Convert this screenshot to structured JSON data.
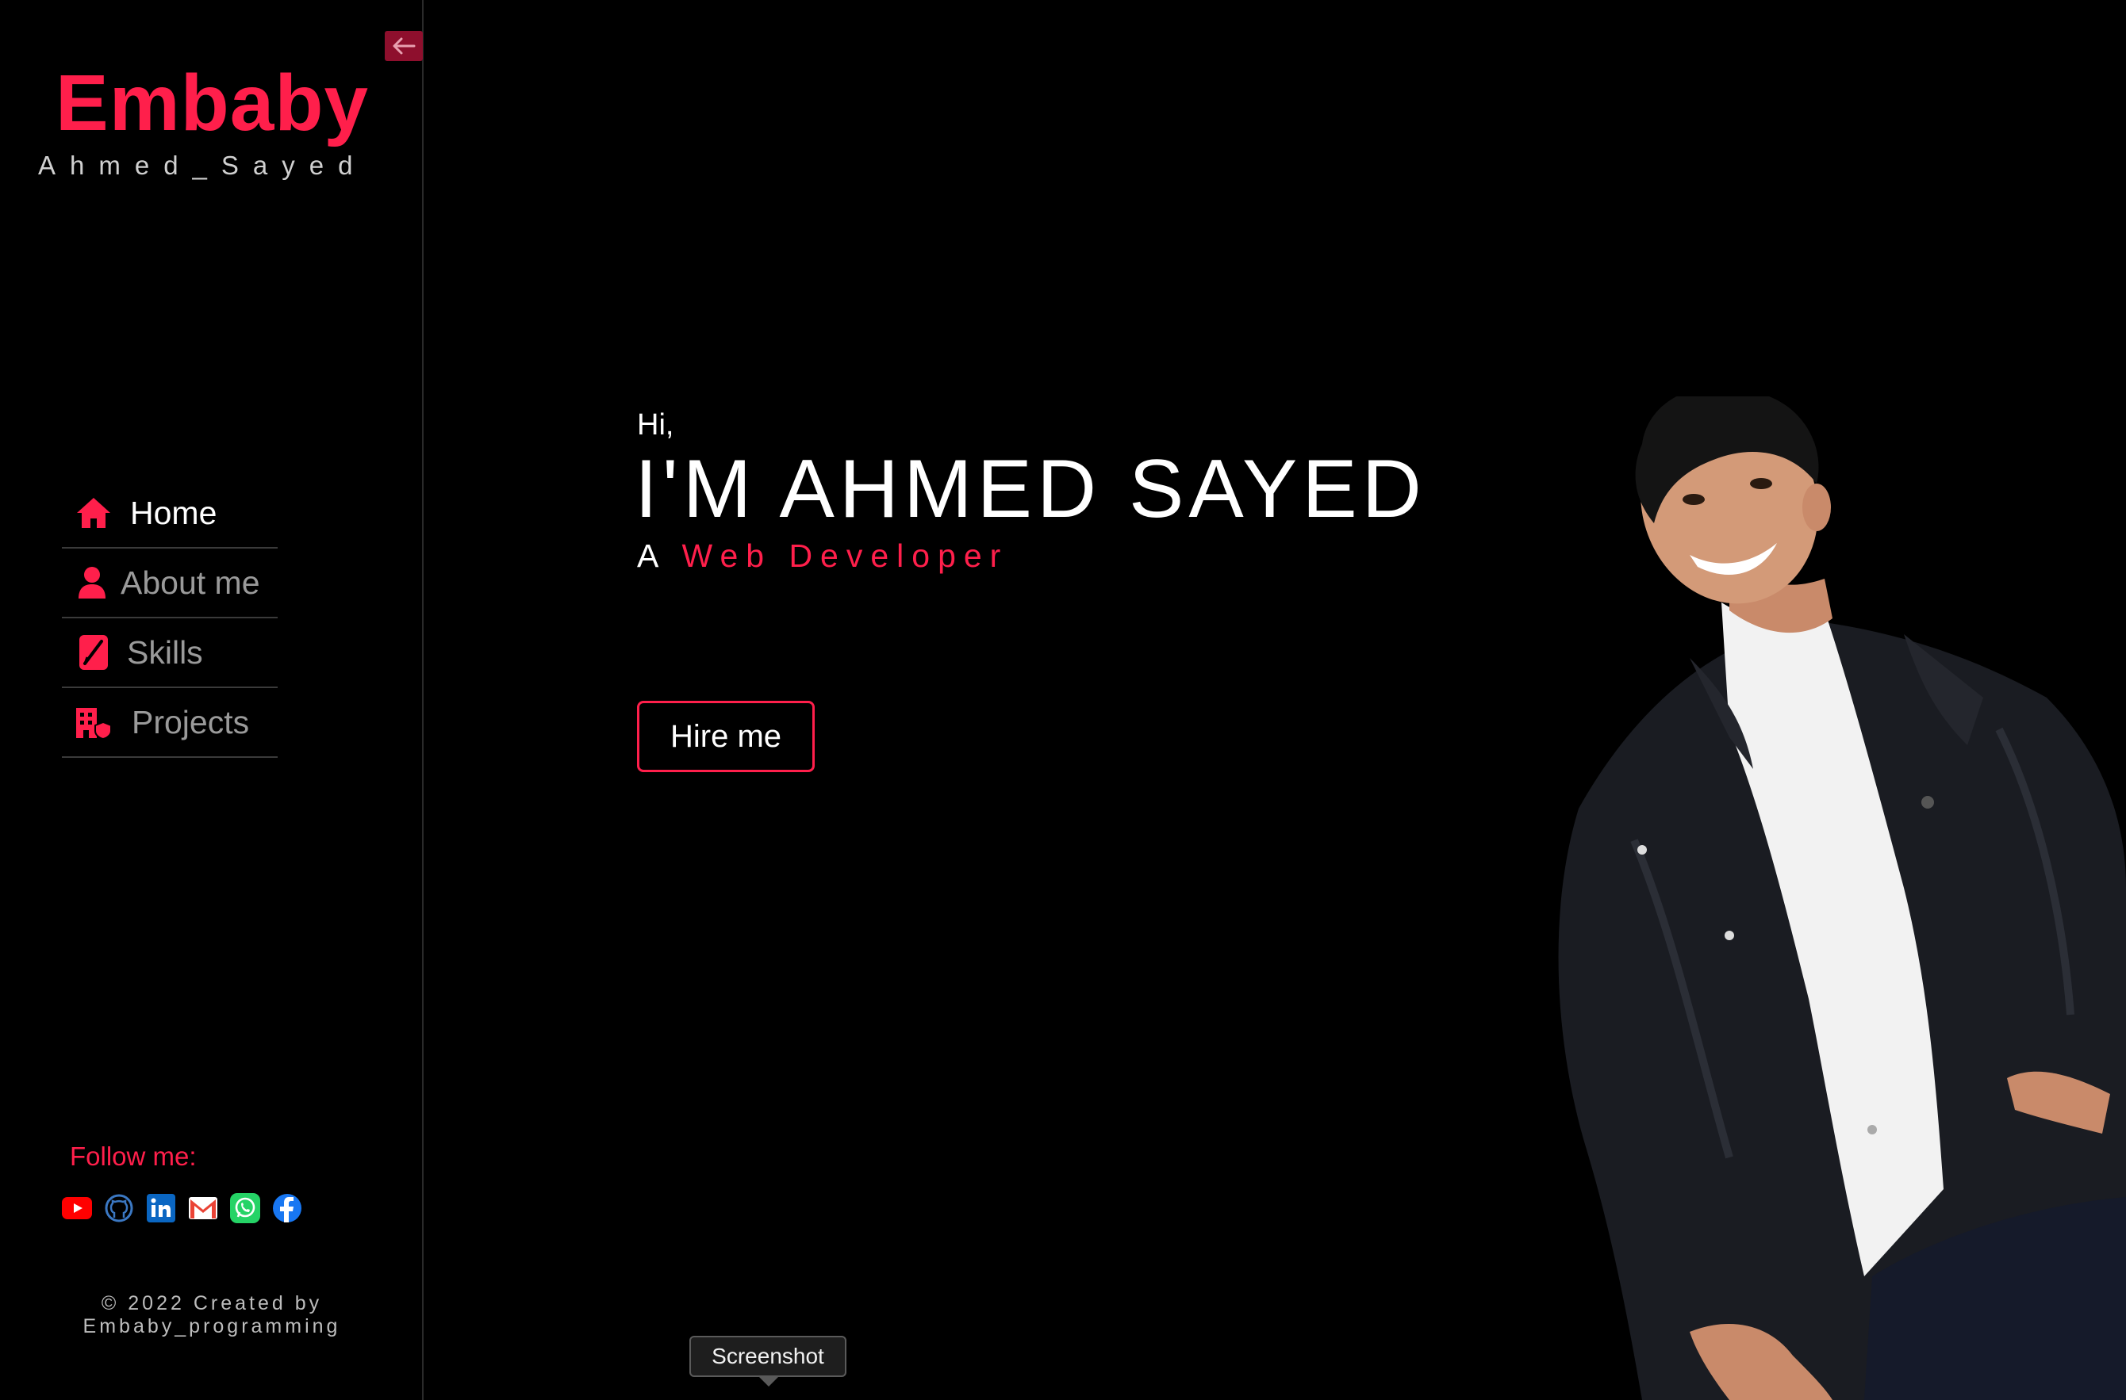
{
  "sidebar": {
    "collapse_icon": "arrow-left-icon",
    "brand_name": "Embaby",
    "brand_sub": "Ahmed_Sayed",
    "nav": [
      {
        "label": "Home",
        "icon": "home-icon",
        "active": true
      },
      {
        "label": "About me",
        "icon": "user-icon",
        "active": false
      },
      {
        "label": "Skills",
        "icon": "skills-icon",
        "active": false
      },
      {
        "label": "Projects",
        "icon": "projects-icon",
        "active": false
      }
    ],
    "follow_label": "Follow me:",
    "socials": [
      {
        "name": "YouTube",
        "icon": "youtube-icon",
        "color": "#ff0000"
      },
      {
        "name": "GitHub",
        "icon": "github-icon",
        "color": "#3b78c3"
      },
      {
        "name": "LinkedIn",
        "icon": "linkedin-icon",
        "color": "#0a66c2"
      },
      {
        "name": "Gmail",
        "icon": "gmail-icon",
        "color": "#ea4335"
      },
      {
        "name": "WhatsApp",
        "icon": "whatsapp-icon",
        "color": "#25d366"
      },
      {
        "name": "Facebook",
        "icon": "facebook-icon",
        "color": "#1877f2"
      }
    ],
    "copyright_line1": "© 2022 Created by",
    "copyright_line2": "Embaby_programming"
  },
  "hero": {
    "greeting": "Hi,",
    "name": "I'M AHMED SAYED",
    "role_prefix": "A",
    "role_highlight": "Web Developer",
    "cta_label": "Hire me"
  },
  "tooltip": {
    "label": "Screenshot"
  },
  "colors": {
    "accent": "#ff1f4b",
    "background": "#000000",
    "muted_text": "#9a9a9a"
  }
}
